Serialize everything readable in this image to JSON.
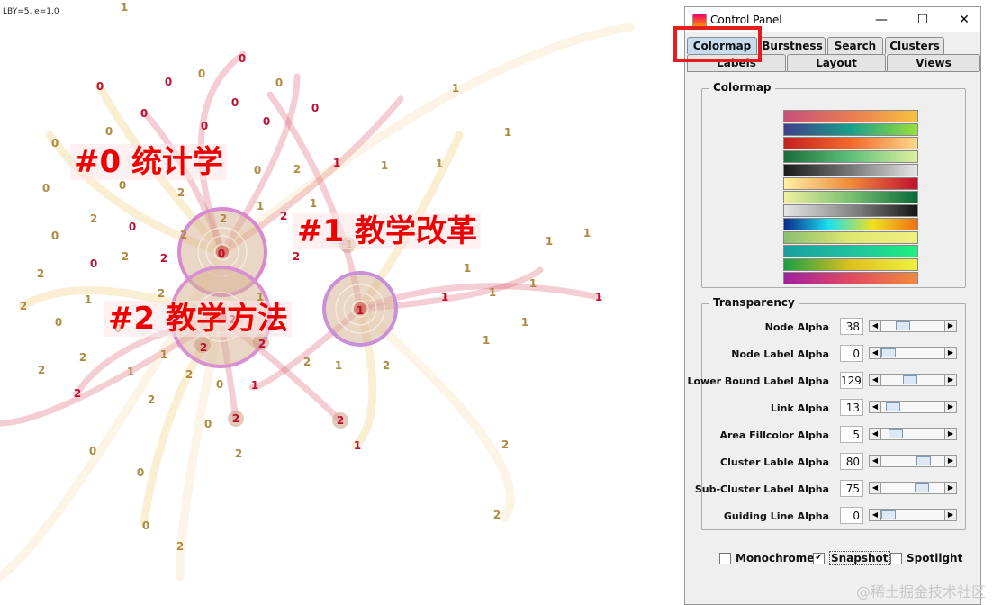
{
  "canvas": {
    "info_text": "LBY=5, e=1.0",
    "clusters": [
      {
        "label": "#0 统计学",
        "node": "0"
      },
      {
        "label": "#1 教学改革",
        "node": "1"
      },
      {
        "label": "#2 教学方法",
        "node": "2"
      }
    ]
  },
  "window": {
    "title": "Control Panel",
    "minimize": "—",
    "maximize": "☐",
    "close": "✕"
  },
  "tabs": {
    "row1": [
      "Colormap",
      "Burstness",
      "Search",
      "Clusters"
    ],
    "row2": [
      "Labels",
      "Layout",
      "Views"
    ],
    "active": "Colormap"
  },
  "colormap": {
    "title": "Colormap",
    "gradients": [
      [
        "#c8507a",
        "#e87a55",
        "#f6c33e"
      ],
      [
        "#3f3f8a",
        "#1aa08a",
        "#9adf3a"
      ],
      [
        "#c42020",
        "#f26a2a",
        "#fdd98a"
      ],
      [
        "#1a6e3a",
        "#5ec07a",
        "#e0f0a0"
      ],
      [
        "#1a1a1a",
        "#777777",
        "#e6e6e6"
      ],
      [
        "#fff0a0",
        "#f08a3a",
        "#c01030"
      ],
      [
        "#f0f0a0",
        "#7ac070",
        "#0a6a3a"
      ],
      [
        "#e6e6e6",
        "#888888",
        "#151515"
      ],
      [
        "#0a2a8a",
        "#1ae0f0",
        "#f0e020",
        "#f07010"
      ],
      [
        "#8ac070",
        "#e0e870",
        "#f0f080"
      ],
      [
        "#18a0a0",
        "#20c0a0",
        "#20f080"
      ],
      [
        "#18a040",
        "#e0c020",
        "#f0f040"
      ],
      [
        "#a020a0",
        "#e04a60",
        "#f08a40"
      ]
    ]
  },
  "transparency": {
    "title": "Transparency",
    "rows": [
      {
        "label": "Node Alpha",
        "value": "38",
        "level": 0.3
      },
      {
        "label": "Node Label Alpha",
        "value": "0",
        "level": 0.0
      },
      {
        "label": "Lower Bound Label Alpha",
        "value": "129",
        "level": 0.44
      },
      {
        "label": "Link Alpha",
        "value": "13",
        "level": 0.1
      },
      {
        "label": "Area Fillcolor Alpha",
        "value": "5",
        "level": 0.14
      },
      {
        "label": "Cluster Lable Alpha",
        "value": "80",
        "level": 0.72
      },
      {
        "label": "Sub-Cluster Label Alpha",
        "value": "75",
        "level": 0.69
      },
      {
        "label": "Guiding Line Alpha",
        "value": "0",
        "level": 0.0
      }
    ]
  },
  "options": {
    "monochrome": {
      "label": "Monochrome",
      "checked": false
    },
    "snapshot": {
      "label": "Snapshot",
      "checked": true
    },
    "spotlight": {
      "label": "Spotlight",
      "checked": false
    }
  },
  "watermark": "@稀土掘金技术社区"
}
